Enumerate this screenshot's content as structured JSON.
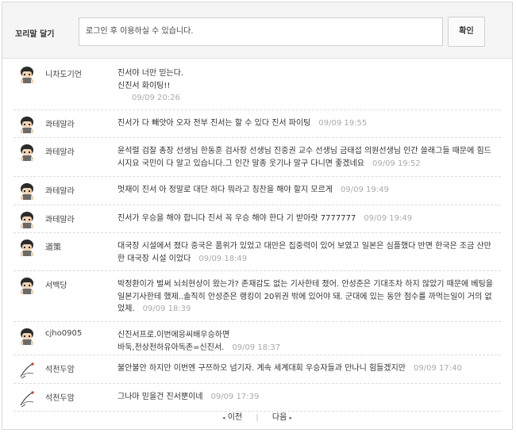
{
  "comment_bar": {
    "label": "꼬리말 달기",
    "input_text": "로그인 후 이용하실 수 있습니다.",
    "confirm_label": "확인"
  },
  "comments": [
    {
      "name": "니차도기언",
      "lines": [
        "진서야 너만 믿는다.",
        "신진서 화이팅!!"
      ],
      "date": "09/09 20:26"
    },
    {
      "name": "콰테말라",
      "lines": [
        "진서가 다 빼앗아 오자 전부 진서는 할 수 있다 진서 파이팅"
      ],
      "date": "09/09 19:55"
    },
    {
      "name": "콰테말라",
      "lines": [
        "윤석렬 검찰 총장 선생님 한동훈 검사장 선생님 진중권 교수 선생님 금태섭 의원선생님 인간 쓸래그들 때문에 힘드시지요 국민이 다 알고 있습니다.그 인간 말종 웃기나 말구 다니면 좋겠네요"
      ],
      "date": "09/09 19:52"
    },
    {
      "name": "콰테말라",
      "lines": [
        "멋재이 진서 아 정말로 대단 하다 뭐라고 칭찬을 해야 할지 모르게"
      ],
      "date": "09/09 19:49"
    },
    {
      "name": "콰테말라",
      "lines": [
        "진서가 우승을 해야 합니다 진서 꼭 우승 해야 한다 기 받아랏 7777777"
      ],
      "date": "09/09 19:49"
    },
    {
      "name": "道策",
      "lines": [
        "대국장 시설에서 졌다 중국은 품위가 있었고 대만은 집중력이 있어 보였고 일본은 심플했다 반면 한국은 조금 산만한 대국장 시설 이었다"
      ],
      "date": "09/09 18:49"
    },
    {
      "name": "서백당",
      "lines": [
        "박정환이가 벌써 뇌쇠현상이 왔는가? 존재감도 없는 기사한테 졌어. 안성준은 기대조차 하지 않았기 때문에 베팅을 일본기사한테 했제..솔직히 안성준은 랭킹이 20위권 밖에 있어야 돼. 군대에 있는 동안 점수를 까먹는일이 거의 없었제."
      ],
      "date": "09/09 18:39"
    },
    {
      "name": "cjho0905",
      "lines": [
        "신진서프로.이번에응씨배우승하면",
        "바둑,천상천하유아독존=신진서."
      ],
      "date": "09/09 18:37"
    },
    {
      "name": "석천두암",
      "lines": [
        "불안불안 하지만 이번엔 구쯔하오 넘기자. 계속 세계대회 우승자들과 만나니 힘들겠지만"
      ],
      "date": "09/09 17:40"
    },
    {
      "name": "석천두암",
      "lines": [
        "그나마 믿을건 진서뿐이네"
      ],
      "date": "09/09 17:39"
    }
  ],
  "pager": {
    "prev_label": "이전",
    "next_label": "다음",
    "separator": "|",
    "prev_icon": "◂",
    "next_icon": "▸"
  },
  "icons": {
    "avatar_boy": "boy-avatar-icon",
    "avatar_crane": "crane-avatar-icon"
  }
}
